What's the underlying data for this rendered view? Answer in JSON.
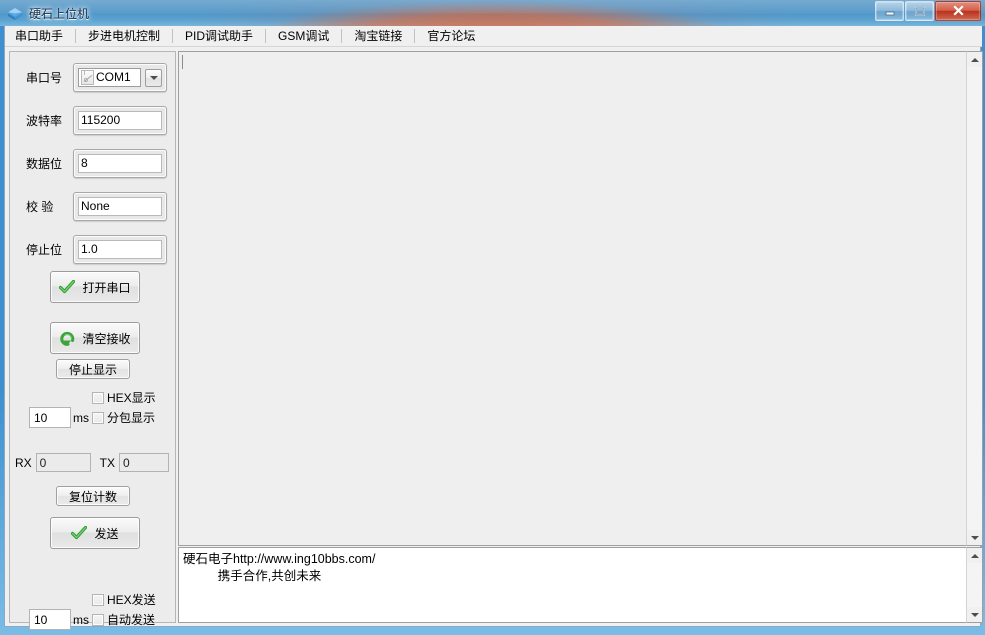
{
  "window": {
    "title": "硬石上位机",
    "icon": "app-diamond-icon",
    "buttons": {
      "minimize": "minimize-icon",
      "maximize": "maximize-icon",
      "close": "close-icon"
    },
    "accent_color": "#3f8fce",
    "close_color": "#c4412c"
  },
  "menubar": {
    "items": [
      {
        "label": "串口助手"
      },
      {
        "label": "步进电机控制"
      },
      {
        "label": "PID调试助手"
      },
      {
        "label": "GSM调试"
      },
      {
        "label": "淘宝链接"
      },
      {
        "label": "官方论坛"
      }
    ]
  },
  "config_panel": {
    "fields": [
      {
        "label": "串口号",
        "value": "COM1",
        "type": "combobox",
        "icon": "io-port-icon"
      },
      {
        "label": "波特率",
        "value": "115200",
        "type": "textbox"
      },
      {
        "label": "数据位",
        "value": "8",
        "type": "textbox"
      },
      {
        "label": "校 验",
        "value": "None",
        "type": "textbox"
      },
      {
        "label": "停止位",
        "value": "1.0",
        "type": "textbox"
      }
    ],
    "open_port_button": {
      "label": "打开串口",
      "icon": "green-check-icon"
    },
    "clear_recv_button": {
      "label": "清空接收",
      "icon": "green-arrow-icon"
    },
    "stop_display_button": {
      "label": "停止显示"
    },
    "hex_display_checkbox": {
      "label": "HEX显示",
      "checked": false
    },
    "packet_display_checkbox": {
      "label": "分包显示",
      "checked": false
    },
    "display_interval": {
      "value": "10",
      "unit": "ms"
    },
    "counters": {
      "rx_label": "RX",
      "rx_value": "0",
      "tx_label": "TX",
      "tx_value": "0"
    },
    "reset_count_button": {
      "label": "复位计数"
    },
    "send_button": {
      "label": "发送",
      "icon": "green-check-icon"
    },
    "hex_send_checkbox": {
      "label": "HEX发送",
      "checked": false
    },
    "auto_send_checkbox": {
      "label": "自动发送",
      "checked": false
    },
    "send_interval": {
      "value": "10",
      "unit": "ms"
    }
  },
  "receive_area": {
    "text": ""
  },
  "send_area": {
    "line1": "硬石电子http://www.ing10bbs.com/",
    "line2": "          携手合作,共创未来"
  },
  "scrollbars": {
    "up_arrow": "scroll-up-icon",
    "down_arrow": "scroll-down-icon"
  }
}
